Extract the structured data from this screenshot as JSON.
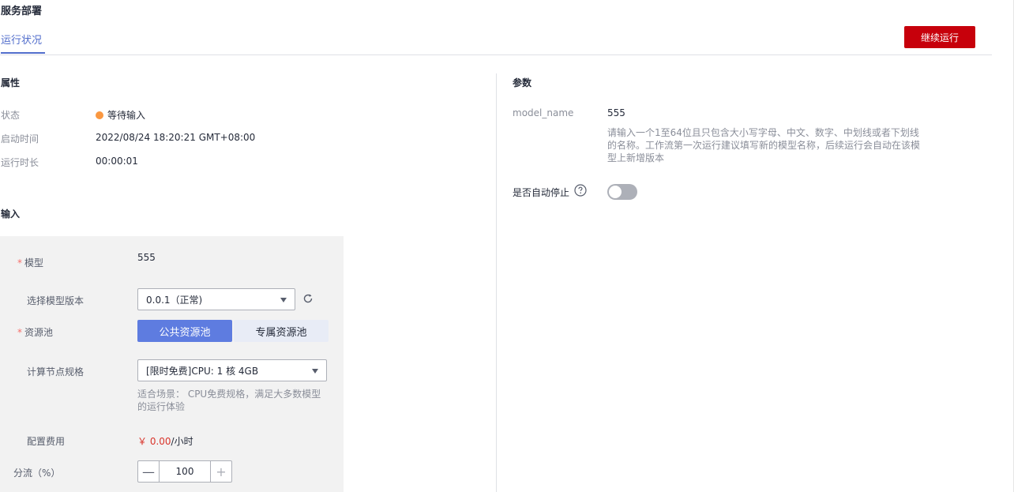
{
  "page": {
    "title": "服务部署",
    "tab": "运行状况",
    "continue_button": "继续运行"
  },
  "properties": {
    "title": "属性",
    "status_label": "状态",
    "status_value": "等待输入",
    "status_color": "#fa9841",
    "start_time_label": "启动时间",
    "start_time_value": "2022/08/24 18:20:21 GMT+08:00",
    "duration_label": "运行时长",
    "duration_value": "00:00:01"
  },
  "input": {
    "title": "输入",
    "model_label": "模型",
    "model_value": "555",
    "version_label": "选择模型版本",
    "version_value": "0.0.1（正常)",
    "pool_label": "资源池",
    "pool_public": "公共资源池",
    "pool_dedicated": "专属资源池",
    "spec_label": "计算节点规格",
    "spec_value": "[限时免费]CPU: 1 核 4GB",
    "spec_hint_line1": "适合场景： CPU免费规格，满足大多数模型",
    "spec_hint_line2": "的运行体验",
    "cost_label": "配置费用",
    "cost_amount": "￥ 0.00",
    "cost_unit": "/小时",
    "split_label": "分流（%）",
    "split_value": "100"
  },
  "params": {
    "title": "参数",
    "model_name_label": "model_name",
    "model_name_value": "555",
    "model_name_hint_line1": "请输入一个1至64位且只包含大小写字母、中文、数字、中划线或者下划线",
    "model_name_hint_line2": "的名称。工作流第一次运行建议填写新的模型名称，后续运行会自动在该模",
    "model_name_hint_line3": "型上新增版本",
    "auto_stop_label": "是否自动停止",
    "auto_stop_enabled": false
  },
  "colors": {
    "accent": "#526ecc",
    "primary_button": "#c7000b",
    "pool_active": "#5e7ce0",
    "price": "#d9342b"
  }
}
